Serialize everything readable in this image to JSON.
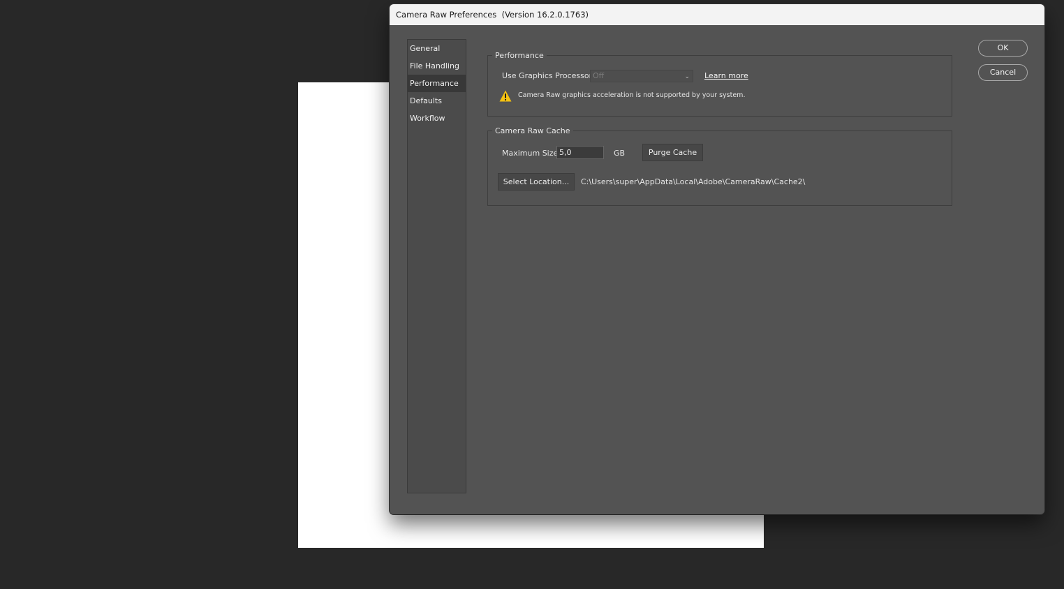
{
  "window": {
    "title": "Camera Raw Preferences  (Version 16.2.0.1763)"
  },
  "nav": {
    "items": [
      {
        "label": "General"
      },
      {
        "label": "File Handling"
      },
      {
        "label": "Performance"
      },
      {
        "label": "Defaults"
      },
      {
        "label": "Workflow"
      }
    ],
    "selected": "Performance"
  },
  "performance": {
    "group_title": "Performance",
    "gpu_label": "Use Graphics Processor:",
    "gpu_value": "Off",
    "learn_more": "Learn more",
    "warning_text": "Camera Raw graphics acceleration is not supported by your system.",
    "warning_icon": "warning-triangle-icon"
  },
  "cache": {
    "group_title": "Camera Raw Cache",
    "max_size_label": "Maximum Size:",
    "max_size_value": "5,0",
    "unit": "GB",
    "purge_label": "Purge Cache",
    "select_location_label": "Select Location...",
    "path": "C:\\Users\\super\\AppData\\Local\\Adobe\\CameraRaw\\Cache2\\"
  },
  "actions": {
    "ok_label": "OK",
    "cancel_label": "Cancel"
  },
  "colors": {
    "app_background": "#282828",
    "dialog_background": "#535353",
    "title_bar": "#f3f3f3",
    "warning_yellow": "#f5c211"
  }
}
